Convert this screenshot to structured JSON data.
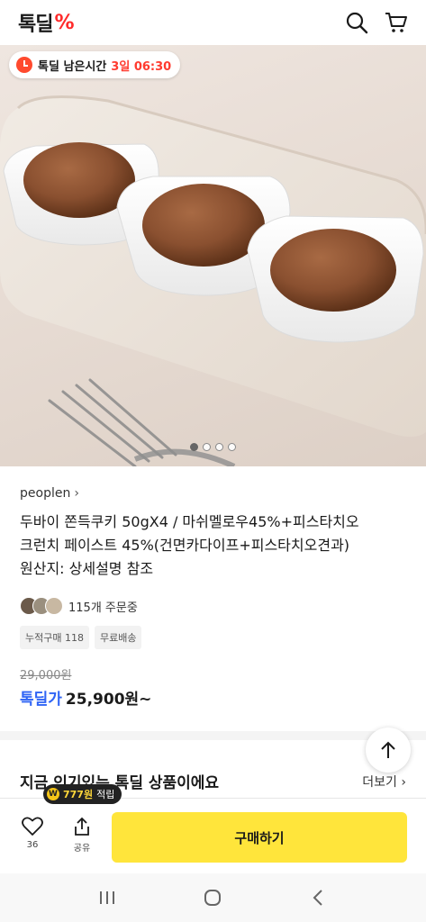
{
  "header": {
    "logo_text": "톡딜",
    "logo_mark": "%",
    "icons": [
      "search-icon",
      "cart-icon"
    ]
  },
  "hero": {
    "timer_label": "톡딜 남은시간",
    "timer_value": "3일 06:30",
    "carousel_total": 4,
    "carousel_active": 1
  },
  "product": {
    "seller": "peoplen",
    "title_line1": "두바이 쫀득쿠키 50gX4 / 마쉬멜로우45%+피스타치오",
    "title_line2": "크런치 페이스트 45%(건면카다이프+피스타치오견과)",
    "title_line3": "원산지: 상세설명 참조",
    "orders_text": "115개 주문중",
    "tags": [
      "누적구매 118",
      "무료배송"
    ],
    "original_price": "29,000원",
    "deal_label": "톡딜가",
    "deal_price": "25,900원~"
  },
  "section": {
    "popular_title": "지금 인기있는 톡딜 상품이에요",
    "more_label": "더보기"
  },
  "actionbar": {
    "like_count": "36",
    "share_label": "공유",
    "buy_label": "구매하기",
    "points_coin": "W",
    "points_amount": "777원",
    "points_label": "적립"
  },
  "colors": {
    "deal_blue": "#2f64f5",
    "buy_yellow": "#ffe53b",
    "logo_red": "#ff2b2b",
    "timer_red": "#ff3b2f"
  }
}
